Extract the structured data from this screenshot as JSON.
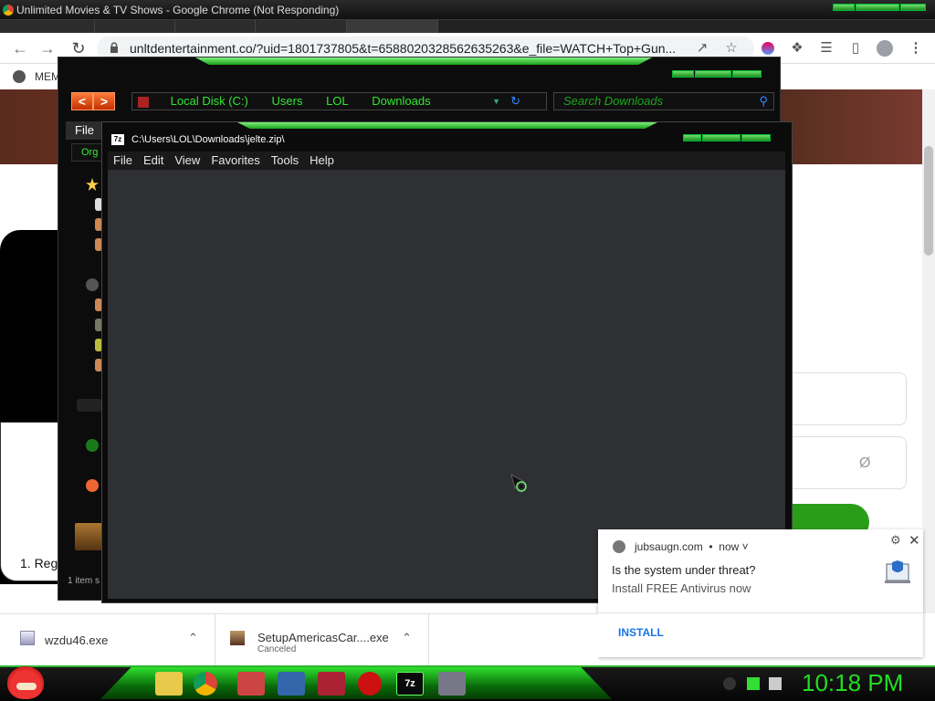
{
  "chrome": {
    "window_title": "Unlimited Movies & TV Shows - Google Chrome (Not Responding)",
    "url": "unltdentertainment.co/?uid=1801737805&t=6588020328562635263&e_file=WATCH+Top+Gun...",
    "bookmark_label": "MEM"
  },
  "page": {
    "list_item_text": "1. Reg"
  },
  "explorer": {
    "path_items": [
      "Local Disk (C:)",
      "Users",
      "LOL",
      "Downloads"
    ],
    "search_placeholder": "Search Downloads",
    "file_menu": "File",
    "org_label": "Org",
    "status_text": "1 item s"
  },
  "zip": {
    "title": "C:\\Users\\LOL\\Downloads\\jelte.zip\\",
    "icon_text": "7z",
    "menu": [
      "File",
      "Edit",
      "View",
      "Favorites",
      "Tools",
      "Help"
    ]
  },
  "notification": {
    "site": "jubsaugn.com",
    "time": "now",
    "title": "Is the system under threat?",
    "body": "Install FREE Antivirus now",
    "action": "INSTALL"
  },
  "downloads": [
    {
      "name": "wzdu46.exe",
      "status": ""
    },
    {
      "name": "SetupAmericasCar....exe",
      "status": "Canceled"
    }
  ],
  "taskbar": {
    "clock": "10:18 PM",
    "active_app_label": "7z"
  }
}
